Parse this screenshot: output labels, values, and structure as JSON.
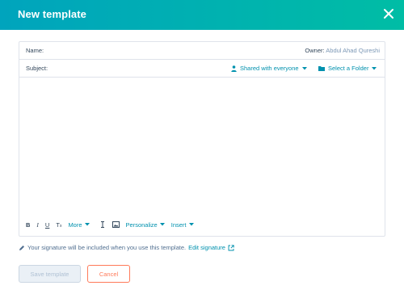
{
  "modal": {
    "title": "New template",
    "header_gradient": [
      "#00a4bd",
      "#00bda5"
    ],
    "close_icon": "close-icon"
  },
  "form": {
    "name_label": "Name:",
    "owner_label": "Owner:",
    "owner_name": "Abdul Ahad Qureshi",
    "subject_label": "Subject:",
    "sharing_label": "Shared with everyone",
    "folder_label": "Select a Folder"
  },
  "toolbar": {
    "bold": "B",
    "italic": "I",
    "underline": "U",
    "clear_format": "T",
    "more": "More",
    "personalize": "Personalize",
    "insert": "Insert"
  },
  "signature": {
    "text": "Your signature will be included when you use this template.",
    "edit_link": "Edit signature"
  },
  "buttons": {
    "save": "Save template",
    "cancel": "Cancel"
  },
  "colors": {
    "accent": "#0091ae",
    "cancel": "#ff7a59",
    "text": "#33475b"
  }
}
